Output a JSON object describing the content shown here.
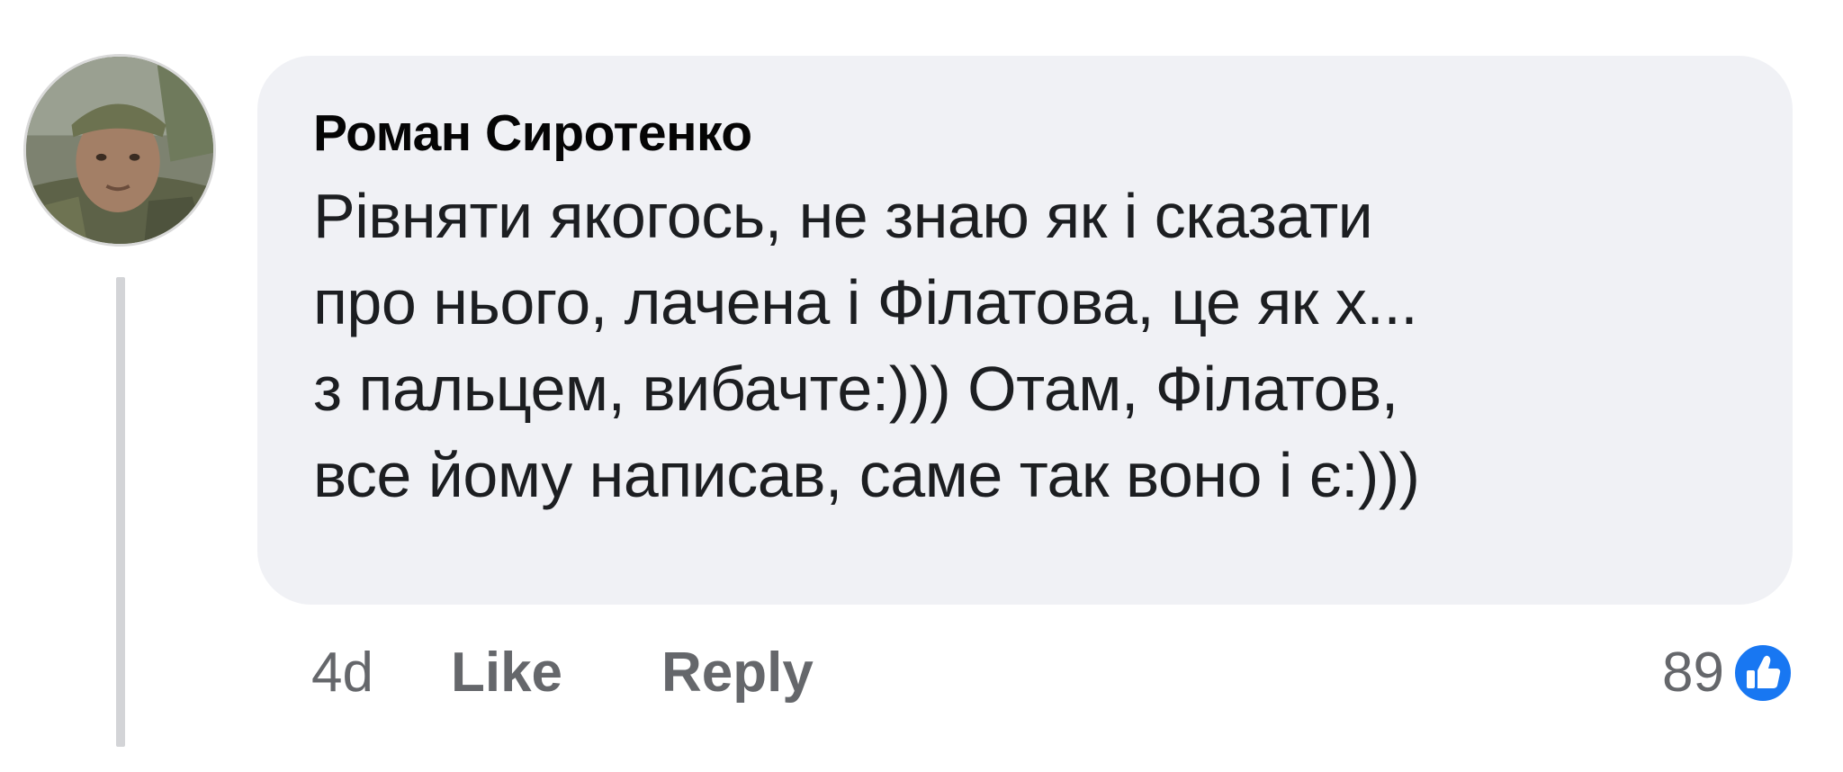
{
  "comment": {
    "author": "Роман Сиротенко",
    "text": "Рівняти якогось, не знаю як і сказати\nпро нього, лачена і Філатова, це як х...\nз пальцем, вибачте:))) Отам, Філатов,\nвсе йому написав, саме так воно і є:)))",
    "age": "4d",
    "like_label": "Like",
    "reply_label": "Reply",
    "reaction_count": "89",
    "reaction_icon": "thumbs-up-icon"
  },
  "colors": {
    "bubble": "#f0f1f5",
    "author": "#050505",
    "text": "#1c1e21",
    "meta": "#65676b",
    "like_blue": "#1877f2",
    "thread_line": "#d3d4d7"
  }
}
